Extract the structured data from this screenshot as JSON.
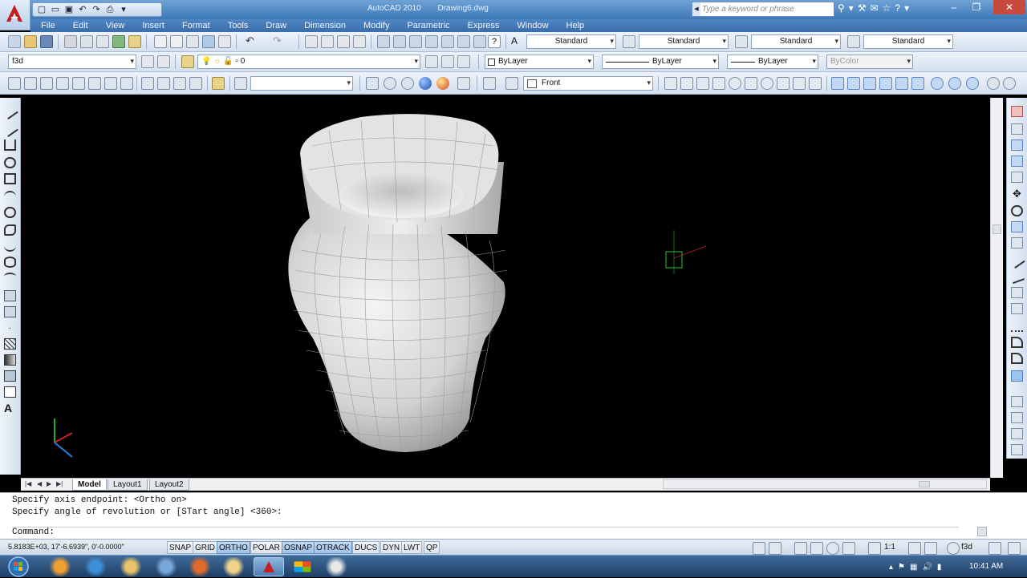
{
  "window": {
    "app_title": "AutoCAD 2010",
    "doc_title": "Drawing6.dwg",
    "search_placeholder": "Type a keyword or phrase"
  },
  "menu": [
    "File",
    "Edit",
    "View",
    "Insert",
    "Format",
    "Tools",
    "Draw",
    "Dimension",
    "Modify",
    "Parametric",
    "Express",
    "Window",
    "Help"
  ],
  "styles_toolbar": {
    "text_style": "Standard",
    "dim_style": "Standard",
    "table_style": "Standard",
    "mleader_style": "Standard"
  },
  "layers_toolbar": {
    "workspace": "f3d",
    "layer": "0"
  },
  "properties_toolbar": {
    "color": "ByLayer",
    "linetype": "ByLayer",
    "lineweight": "ByLayer",
    "plotstyle": "ByColor"
  },
  "view_toolbar": {
    "named_view": "Front"
  },
  "layout_tabs": [
    "Model",
    "Layout1",
    "Layout2"
  ],
  "command": {
    "history": [
      "Specify axis endpoint:  <Ortho on>",
      "Specify angle of revolution or [STart angle] <360>:"
    ],
    "prompt": "Command:"
  },
  "status": {
    "coordinates": "5.8183E+03,  17'-6.6939\", 0'-0.0000\"",
    "buttons": [
      {
        "label": "SNAP",
        "on": false
      },
      {
        "label": "GRID",
        "on": false
      },
      {
        "label": "ORTHO",
        "on": true
      },
      {
        "label": "POLAR",
        "on": false
      },
      {
        "label": "OSNAP",
        "on": true
      },
      {
        "label": "OTRACK",
        "on": true
      },
      {
        "label": "DUCS",
        "on": false
      },
      {
        "label": "DYN",
        "on": false
      },
      {
        "label": "LWT",
        "on": false
      },
      {
        "label": "QP",
        "on": false
      }
    ],
    "annotation_scale": "1:1",
    "workspace": "f3d"
  },
  "taskbar": {
    "clock": "10:41 AM"
  },
  "colors": {
    "viewport_bg": "#000000",
    "title_blue": "#3d78b8",
    "toggle_on": "#9fc1e8",
    "model_vase": "#d8d8d8"
  }
}
